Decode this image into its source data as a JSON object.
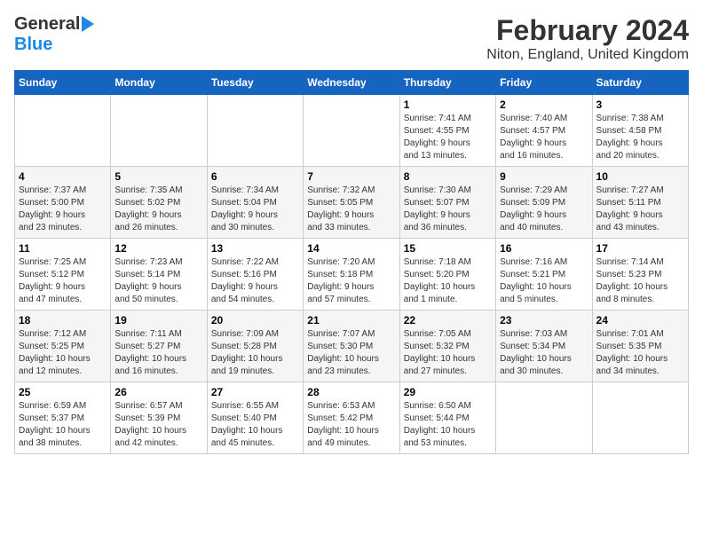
{
  "logo": {
    "general": "General",
    "blue": "Blue"
  },
  "title": "February 2024",
  "subtitle": "Niton, England, United Kingdom",
  "days": [
    "Sunday",
    "Monday",
    "Tuesday",
    "Wednesday",
    "Thursday",
    "Friday",
    "Saturday"
  ],
  "weeks": [
    [
      {
        "num": "",
        "info": ""
      },
      {
        "num": "",
        "info": ""
      },
      {
        "num": "",
        "info": ""
      },
      {
        "num": "",
        "info": ""
      },
      {
        "num": "1",
        "info": "Sunrise: 7:41 AM\nSunset: 4:55 PM\nDaylight: 9 hours\nand 13 minutes."
      },
      {
        "num": "2",
        "info": "Sunrise: 7:40 AM\nSunset: 4:57 PM\nDaylight: 9 hours\nand 16 minutes."
      },
      {
        "num": "3",
        "info": "Sunrise: 7:38 AM\nSunset: 4:58 PM\nDaylight: 9 hours\nand 20 minutes."
      }
    ],
    [
      {
        "num": "4",
        "info": "Sunrise: 7:37 AM\nSunset: 5:00 PM\nDaylight: 9 hours\nand 23 minutes."
      },
      {
        "num": "5",
        "info": "Sunrise: 7:35 AM\nSunset: 5:02 PM\nDaylight: 9 hours\nand 26 minutes."
      },
      {
        "num": "6",
        "info": "Sunrise: 7:34 AM\nSunset: 5:04 PM\nDaylight: 9 hours\nand 30 minutes."
      },
      {
        "num": "7",
        "info": "Sunrise: 7:32 AM\nSunset: 5:05 PM\nDaylight: 9 hours\nand 33 minutes."
      },
      {
        "num": "8",
        "info": "Sunrise: 7:30 AM\nSunset: 5:07 PM\nDaylight: 9 hours\nand 36 minutes."
      },
      {
        "num": "9",
        "info": "Sunrise: 7:29 AM\nSunset: 5:09 PM\nDaylight: 9 hours\nand 40 minutes."
      },
      {
        "num": "10",
        "info": "Sunrise: 7:27 AM\nSunset: 5:11 PM\nDaylight: 9 hours\nand 43 minutes."
      }
    ],
    [
      {
        "num": "11",
        "info": "Sunrise: 7:25 AM\nSunset: 5:12 PM\nDaylight: 9 hours\nand 47 minutes."
      },
      {
        "num": "12",
        "info": "Sunrise: 7:23 AM\nSunset: 5:14 PM\nDaylight: 9 hours\nand 50 minutes."
      },
      {
        "num": "13",
        "info": "Sunrise: 7:22 AM\nSunset: 5:16 PM\nDaylight: 9 hours\nand 54 minutes."
      },
      {
        "num": "14",
        "info": "Sunrise: 7:20 AM\nSunset: 5:18 PM\nDaylight: 9 hours\nand 57 minutes."
      },
      {
        "num": "15",
        "info": "Sunrise: 7:18 AM\nSunset: 5:20 PM\nDaylight: 10 hours\nand 1 minute."
      },
      {
        "num": "16",
        "info": "Sunrise: 7:16 AM\nSunset: 5:21 PM\nDaylight: 10 hours\nand 5 minutes."
      },
      {
        "num": "17",
        "info": "Sunrise: 7:14 AM\nSunset: 5:23 PM\nDaylight: 10 hours\nand 8 minutes."
      }
    ],
    [
      {
        "num": "18",
        "info": "Sunrise: 7:12 AM\nSunset: 5:25 PM\nDaylight: 10 hours\nand 12 minutes."
      },
      {
        "num": "19",
        "info": "Sunrise: 7:11 AM\nSunset: 5:27 PM\nDaylight: 10 hours\nand 16 minutes."
      },
      {
        "num": "20",
        "info": "Sunrise: 7:09 AM\nSunset: 5:28 PM\nDaylight: 10 hours\nand 19 minutes."
      },
      {
        "num": "21",
        "info": "Sunrise: 7:07 AM\nSunset: 5:30 PM\nDaylight: 10 hours\nand 23 minutes."
      },
      {
        "num": "22",
        "info": "Sunrise: 7:05 AM\nSunset: 5:32 PM\nDaylight: 10 hours\nand 27 minutes."
      },
      {
        "num": "23",
        "info": "Sunrise: 7:03 AM\nSunset: 5:34 PM\nDaylight: 10 hours\nand 30 minutes."
      },
      {
        "num": "24",
        "info": "Sunrise: 7:01 AM\nSunset: 5:35 PM\nDaylight: 10 hours\nand 34 minutes."
      }
    ],
    [
      {
        "num": "25",
        "info": "Sunrise: 6:59 AM\nSunset: 5:37 PM\nDaylight: 10 hours\nand 38 minutes."
      },
      {
        "num": "26",
        "info": "Sunrise: 6:57 AM\nSunset: 5:39 PM\nDaylight: 10 hours\nand 42 minutes."
      },
      {
        "num": "27",
        "info": "Sunrise: 6:55 AM\nSunset: 5:40 PM\nDaylight: 10 hours\nand 45 minutes."
      },
      {
        "num": "28",
        "info": "Sunrise: 6:53 AM\nSunset: 5:42 PM\nDaylight: 10 hours\nand 49 minutes."
      },
      {
        "num": "29",
        "info": "Sunrise: 6:50 AM\nSunset: 5:44 PM\nDaylight: 10 hours\nand 53 minutes."
      },
      {
        "num": "",
        "info": ""
      },
      {
        "num": "",
        "info": ""
      }
    ]
  ]
}
